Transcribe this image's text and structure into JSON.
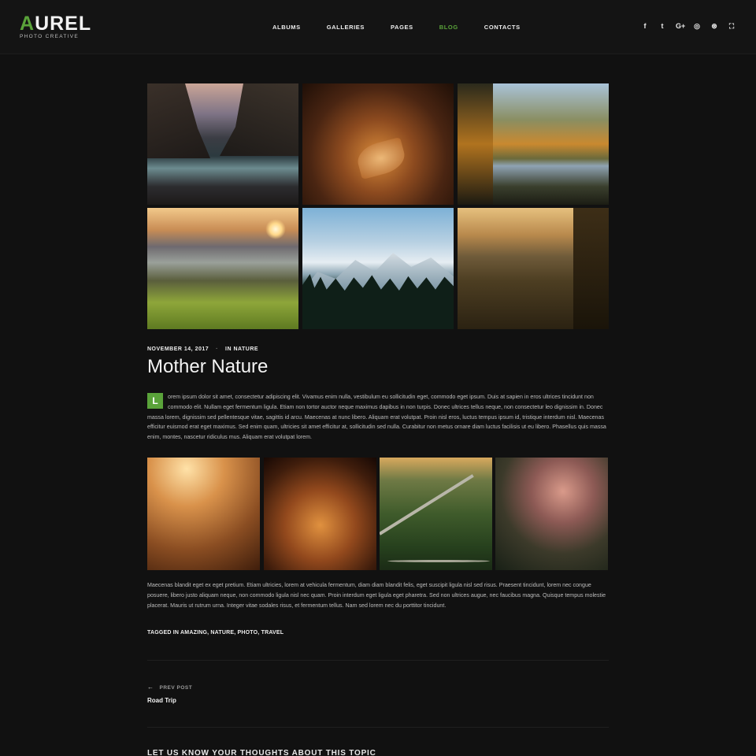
{
  "logo": {
    "first_letter": "A",
    "rest": "UREL",
    "tagline": "PHOTO CREATIVE"
  },
  "nav": {
    "items": [
      {
        "label": "ALBUMS",
        "active": false
      },
      {
        "label": "GALLERIES",
        "active": false
      },
      {
        "label": "PAGES",
        "active": false
      },
      {
        "label": "BLOG",
        "active": true
      },
      {
        "label": "CONTACTS",
        "active": false
      }
    ]
  },
  "social": [
    {
      "icon": "facebook-icon",
      "glyph": "f"
    },
    {
      "icon": "twitter-icon",
      "glyph": "t"
    },
    {
      "icon": "google-plus-icon",
      "glyph": "G+"
    },
    {
      "icon": "instagram-icon",
      "glyph": "◎"
    },
    {
      "icon": "pinterest-icon",
      "glyph": "⊛"
    },
    {
      "icon": "fullscreen-icon",
      "glyph": "⛶"
    }
  ],
  "colors": {
    "accent": "#5aa33a",
    "background": "#111111"
  },
  "gallery_top": [
    {
      "name": "photo-coast",
      "class": "img-coast"
    },
    {
      "name": "photo-autumn-leaves",
      "class": "img-leaves"
    },
    {
      "name": "photo-forest-lake",
      "class": "img-lake"
    },
    {
      "name": "photo-misty-valley",
      "class": "img-valley"
    },
    {
      "name": "photo-snowy-mountains",
      "class": "img-mountain"
    },
    {
      "name": "photo-golden-hills",
      "class": "img-sunset"
    }
  ],
  "post": {
    "date": "NOVEMBER 14, 2017",
    "separator": "·",
    "category": "IN NATURE",
    "title": "Mother Nature",
    "dropcap": "L",
    "paragraph1": "orem ipsum dolor sit amet, consectetur adipiscing elit. Vivamus enim nulla, vestibulum eu sollicitudin eget, commodo eget ipsum. Duis at sapien in eros ultrices tincidunt non commodo elit. Nullam eget fermentum ligula. Etiam non tortor auctor neque maximus dapibus in non turpis. Donec ultrices tellus neque, non consectetur leo dignissim in. Donec massa lorem, dignissim sed pellentesque vitae, sagittis id arcu. Maecenas at nunc libero. Aliquam erat volutpat. Proin nisl eros, luctus tempus ipsum id, tristique interdum nisl. Maecenas efficitur euismod erat eget maximus. Sed enim quam, ultricies sit amet efficitur at, sollicitudin sed nulla. Curabitur non metus ornare diam luctus facilisis ut eu libero. Phasellus quis massa enim, montes, nascetur ridiculus mus. Aliquam erat volutpat lorem.",
    "paragraph2": "Maecenas blandit eget ex eget pretium. Etiam ultricies, lorem at vehicula fermentum, diam diam blandit felis, eget suscipit ligula nisl sed risus. Praesent tincidunt, lorem nec congue posuere, libero justo aliquam neque, non commodo ligula nisl nec quam. Proin interdum eget ligula eget pharetra. Sed non ultrices augue, nec faucibus magna. Quisque tempus molestie placerat. Mauris ut rutrum urna. Integer vitae sodales risus, et fermentum tellus. Nam sed lorem nec du porttitor tincidunt.",
    "tags": "TAGGED IN AMAZING, NATURE, PHOTO, TRAVEL"
  },
  "gallery_bottom": [
    {
      "name": "photo-wheat-field",
      "class": "img-wheat"
    },
    {
      "name": "photo-leaves-closeup",
      "class": "img-wheat2"
    },
    {
      "name": "photo-aerial-roads",
      "class": "img-road"
    },
    {
      "name": "photo-mushrooms",
      "class": "img-shroom"
    }
  ],
  "navigation": {
    "prev_label": "PREV POST",
    "prev_arrow": "←",
    "prev_title": "Road Trip"
  },
  "comments": {
    "heading": "LET US KNOW YOUR THOUGHTS ABOUT THIS TOPIC"
  }
}
